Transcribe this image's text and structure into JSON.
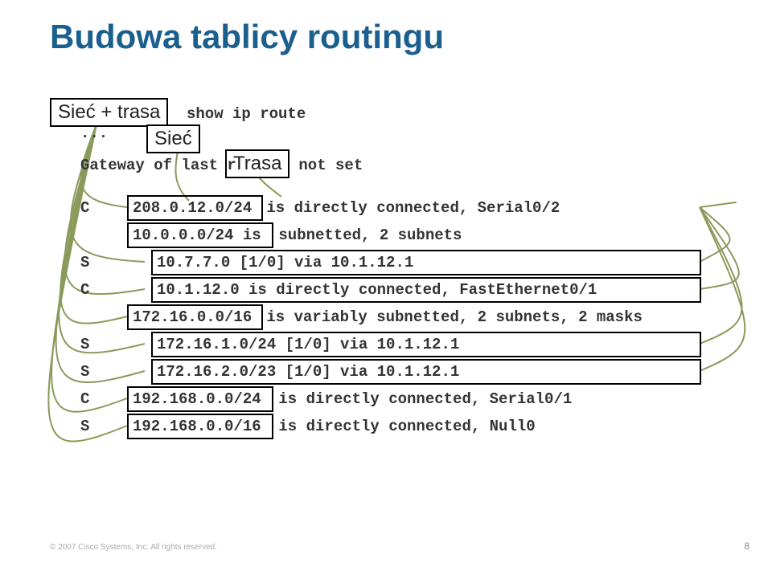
{
  "title": "Budowa tablicy routingu",
  "labels": {
    "siec_trasa": "Sieć + trasa",
    "siec": "Sieć",
    "trasa": "Trasa"
  },
  "cli": {
    "cmd_frag": "show ip route",
    "dots": "...",
    "gateway_pre": "Gateway of last r",
    "gateway_post": " not set",
    "lines": {
      "l1_code": "C",
      "l1_net": "208.0.12.0/24",
      "l1_rest": " is directly connected, Serial0/2",
      "l2_net": "10.0.0.0/24 is",
      "l2_rest": " subnetted, 2 subnets",
      "l3_code": "S",
      "l3_route": "10.7.7.0 [1/0] via 10.1.12.1",
      "l4_code": "C",
      "l4_route": "10.1.12.0 is directly connected, FastEthernet0/1",
      "l5_net": "172.16.0.0/16",
      "l5_rest": " is variably subnetted, 2 subnets, 2 masks",
      "l6_code": "S",
      "l6_route": "172.16.1.0/24 [1/0] via 10.1.12.1",
      "l7_code": "S",
      "l7_route": "172.16.2.0/23 [1/0] via 10.1.12.1",
      "l8_code": "C",
      "l8_net": "192.168.0.0/24",
      "l8_rest": " is directly connected, Serial0/1",
      "l9_code": "S",
      "l9_net": "192.168.0.0/16",
      "l9_rest": " is directly connected, Null0"
    }
  },
  "footer": "© 2007 Cisco Systems, Inc. All rights reserved.",
  "page": "8"
}
